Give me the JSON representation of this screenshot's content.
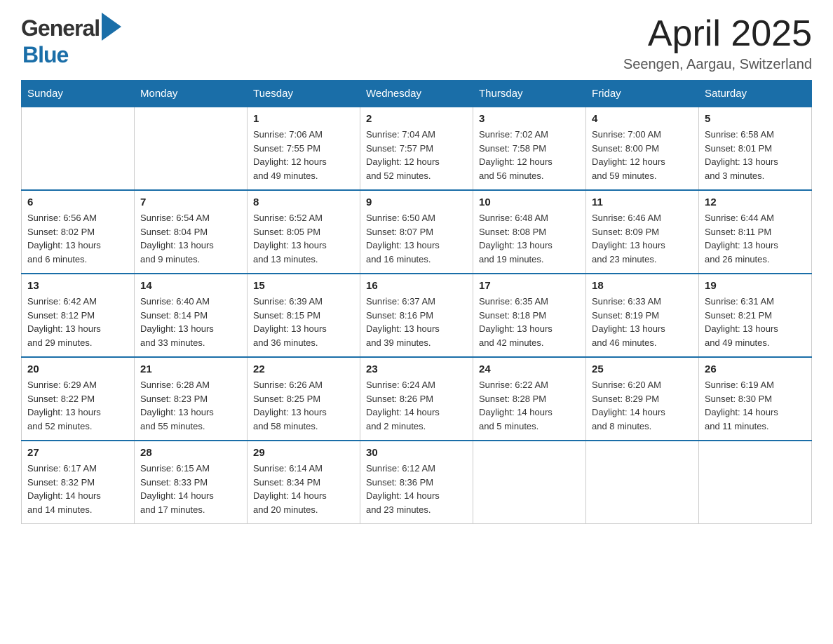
{
  "header": {
    "logo_general": "General",
    "logo_blue": "Blue",
    "title": "April 2025",
    "subtitle": "Seengen, Aargau, Switzerland"
  },
  "weekdays": [
    "Sunday",
    "Monday",
    "Tuesday",
    "Wednesday",
    "Thursday",
    "Friday",
    "Saturday"
  ],
  "weeks": [
    [
      {
        "day": "",
        "info": ""
      },
      {
        "day": "",
        "info": ""
      },
      {
        "day": "1",
        "info": "Sunrise: 7:06 AM\nSunset: 7:55 PM\nDaylight: 12 hours\nand 49 minutes."
      },
      {
        "day": "2",
        "info": "Sunrise: 7:04 AM\nSunset: 7:57 PM\nDaylight: 12 hours\nand 52 minutes."
      },
      {
        "day": "3",
        "info": "Sunrise: 7:02 AM\nSunset: 7:58 PM\nDaylight: 12 hours\nand 56 minutes."
      },
      {
        "day": "4",
        "info": "Sunrise: 7:00 AM\nSunset: 8:00 PM\nDaylight: 12 hours\nand 59 minutes."
      },
      {
        "day": "5",
        "info": "Sunrise: 6:58 AM\nSunset: 8:01 PM\nDaylight: 13 hours\nand 3 minutes."
      }
    ],
    [
      {
        "day": "6",
        "info": "Sunrise: 6:56 AM\nSunset: 8:02 PM\nDaylight: 13 hours\nand 6 minutes."
      },
      {
        "day": "7",
        "info": "Sunrise: 6:54 AM\nSunset: 8:04 PM\nDaylight: 13 hours\nand 9 minutes."
      },
      {
        "day": "8",
        "info": "Sunrise: 6:52 AM\nSunset: 8:05 PM\nDaylight: 13 hours\nand 13 minutes."
      },
      {
        "day": "9",
        "info": "Sunrise: 6:50 AM\nSunset: 8:07 PM\nDaylight: 13 hours\nand 16 minutes."
      },
      {
        "day": "10",
        "info": "Sunrise: 6:48 AM\nSunset: 8:08 PM\nDaylight: 13 hours\nand 19 minutes."
      },
      {
        "day": "11",
        "info": "Sunrise: 6:46 AM\nSunset: 8:09 PM\nDaylight: 13 hours\nand 23 minutes."
      },
      {
        "day": "12",
        "info": "Sunrise: 6:44 AM\nSunset: 8:11 PM\nDaylight: 13 hours\nand 26 minutes."
      }
    ],
    [
      {
        "day": "13",
        "info": "Sunrise: 6:42 AM\nSunset: 8:12 PM\nDaylight: 13 hours\nand 29 minutes."
      },
      {
        "day": "14",
        "info": "Sunrise: 6:40 AM\nSunset: 8:14 PM\nDaylight: 13 hours\nand 33 minutes."
      },
      {
        "day": "15",
        "info": "Sunrise: 6:39 AM\nSunset: 8:15 PM\nDaylight: 13 hours\nand 36 minutes."
      },
      {
        "day": "16",
        "info": "Sunrise: 6:37 AM\nSunset: 8:16 PM\nDaylight: 13 hours\nand 39 minutes."
      },
      {
        "day": "17",
        "info": "Sunrise: 6:35 AM\nSunset: 8:18 PM\nDaylight: 13 hours\nand 42 minutes."
      },
      {
        "day": "18",
        "info": "Sunrise: 6:33 AM\nSunset: 8:19 PM\nDaylight: 13 hours\nand 46 minutes."
      },
      {
        "day": "19",
        "info": "Sunrise: 6:31 AM\nSunset: 8:21 PM\nDaylight: 13 hours\nand 49 minutes."
      }
    ],
    [
      {
        "day": "20",
        "info": "Sunrise: 6:29 AM\nSunset: 8:22 PM\nDaylight: 13 hours\nand 52 minutes."
      },
      {
        "day": "21",
        "info": "Sunrise: 6:28 AM\nSunset: 8:23 PM\nDaylight: 13 hours\nand 55 minutes."
      },
      {
        "day": "22",
        "info": "Sunrise: 6:26 AM\nSunset: 8:25 PM\nDaylight: 13 hours\nand 58 minutes."
      },
      {
        "day": "23",
        "info": "Sunrise: 6:24 AM\nSunset: 8:26 PM\nDaylight: 14 hours\nand 2 minutes."
      },
      {
        "day": "24",
        "info": "Sunrise: 6:22 AM\nSunset: 8:28 PM\nDaylight: 14 hours\nand 5 minutes."
      },
      {
        "day": "25",
        "info": "Sunrise: 6:20 AM\nSunset: 8:29 PM\nDaylight: 14 hours\nand 8 minutes."
      },
      {
        "day": "26",
        "info": "Sunrise: 6:19 AM\nSunset: 8:30 PM\nDaylight: 14 hours\nand 11 minutes."
      }
    ],
    [
      {
        "day": "27",
        "info": "Sunrise: 6:17 AM\nSunset: 8:32 PM\nDaylight: 14 hours\nand 14 minutes."
      },
      {
        "day": "28",
        "info": "Sunrise: 6:15 AM\nSunset: 8:33 PM\nDaylight: 14 hours\nand 17 minutes."
      },
      {
        "day": "29",
        "info": "Sunrise: 6:14 AM\nSunset: 8:34 PM\nDaylight: 14 hours\nand 20 minutes."
      },
      {
        "day": "30",
        "info": "Sunrise: 6:12 AM\nSunset: 8:36 PM\nDaylight: 14 hours\nand 23 minutes."
      },
      {
        "day": "",
        "info": ""
      },
      {
        "day": "",
        "info": ""
      },
      {
        "day": "",
        "info": ""
      }
    ]
  ]
}
